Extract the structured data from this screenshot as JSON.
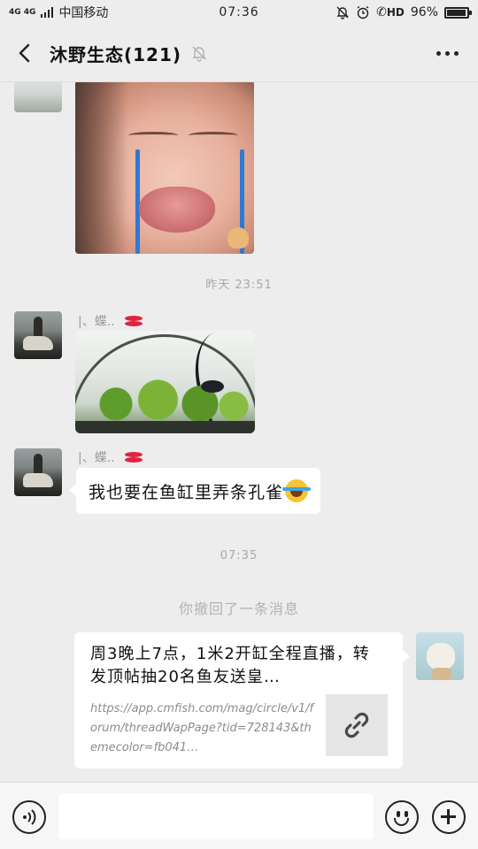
{
  "status_bar": {
    "network": "4G 4G",
    "carrier": "中国移动",
    "time": "07:36",
    "hd_label": "HD",
    "battery": "96%",
    "battery_level": 0.96
  },
  "header": {
    "title": "沐野生态(121)",
    "icons": [
      "back-icon",
      "mute-bell-icon",
      "more-icon"
    ]
  },
  "messages": {
    "timestamp_yesterday": "昨天 23:51",
    "sender_name": "|、蝶..",
    "text_message": "我也要在鱼缸里弄条孔雀",
    "timestamp_today": "07:35",
    "recalled_notice": "你撤回了一条消息",
    "link_card": {
      "title": "周3晚上7点，1米2开缸全程直播，转发顶帖抽20名鱼友送皇…",
      "url": "https://app.cmfish.com/mag/circle/v1/forum/threadWapPage?tid=728143&themecolor=fb041…"
    }
  },
  "input_bar": {
    "text_value": "",
    "icons": [
      "voice-icon",
      "emoji-icon",
      "plus-icon"
    ]
  }
}
